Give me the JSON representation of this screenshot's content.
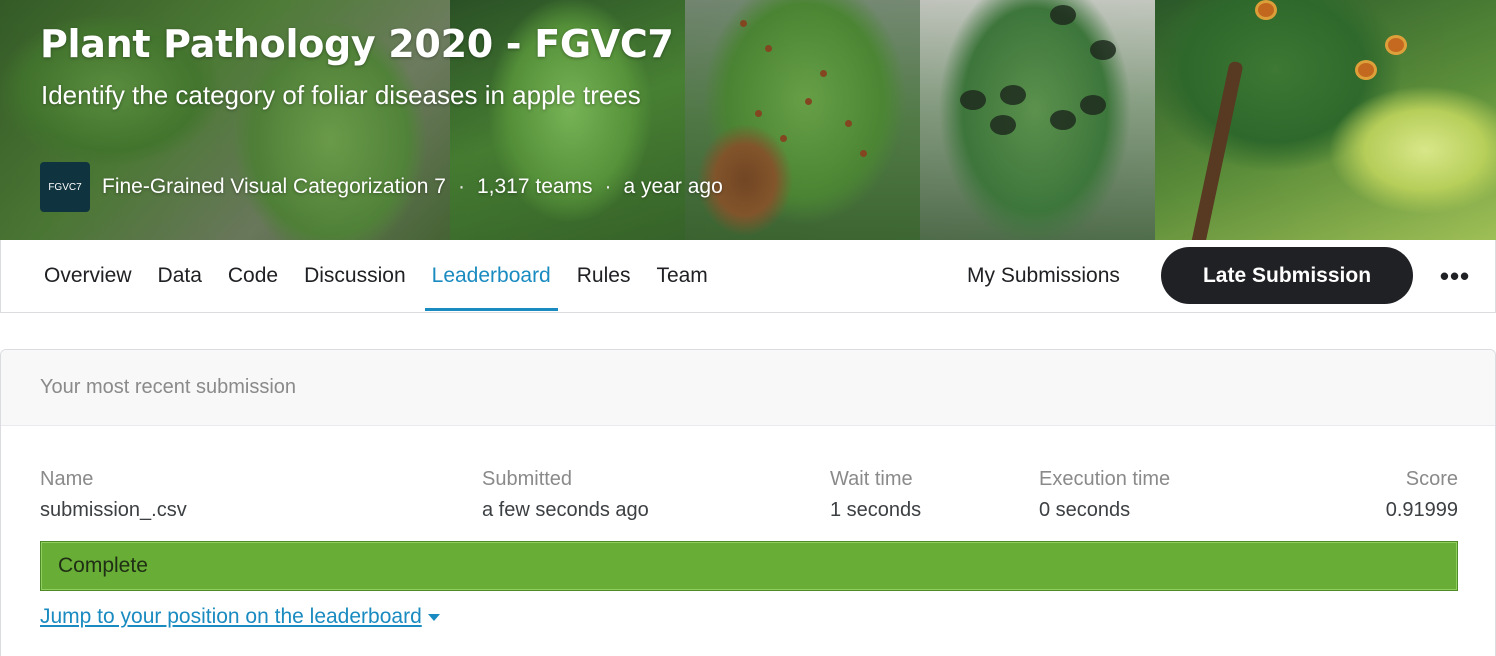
{
  "competition": {
    "title": "Plant Pathology 2020 - FGVC7",
    "subtitle": "Identify the category of foliar diseases in apple trees",
    "org_logo_text": "FGVC7",
    "organizer": "Fine-Grained Visual Categorization 7",
    "teams": "1,317 teams",
    "age": "a year ago",
    "separator": "·"
  },
  "nav": {
    "tabs": [
      {
        "label": "Overview",
        "active": false
      },
      {
        "label": "Data",
        "active": false
      },
      {
        "label": "Code",
        "active": false
      },
      {
        "label": "Discussion",
        "active": false
      },
      {
        "label": "Leaderboard",
        "active": true
      },
      {
        "label": "Rules",
        "active": false
      },
      {
        "label": "Team",
        "active": false
      }
    ],
    "my_submissions": "My Submissions",
    "late_submission": "Late Submission",
    "more_icon": "ellipsis-icon",
    "more_glyph": "•••"
  },
  "submission": {
    "header": "Your most recent submission",
    "columns": {
      "name": {
        "label": "Name",
        "value": "submission_.csv"
      },
      "submitted": {
        "label": "Submitted",
        "value": "a few seconds ago"
      },
      "wait_time": {
        "label": "Wait time",
        "value": "1 seconds"
      },
      "execution_time": {
        "label": "Execution time",
        "value": "0 seconds"
      },
      "score": {
        "label": "Score",
        "value": "0.91999"
      }
    },
    "status": "Complete",
    "jump_link": "Jump to your position on the leaderboard"
  },
  "colors": {
    "accent": "#1a8bc0",
    "status_complete": "#67ad36",
    "button_dark": "#202124"
  }
}
